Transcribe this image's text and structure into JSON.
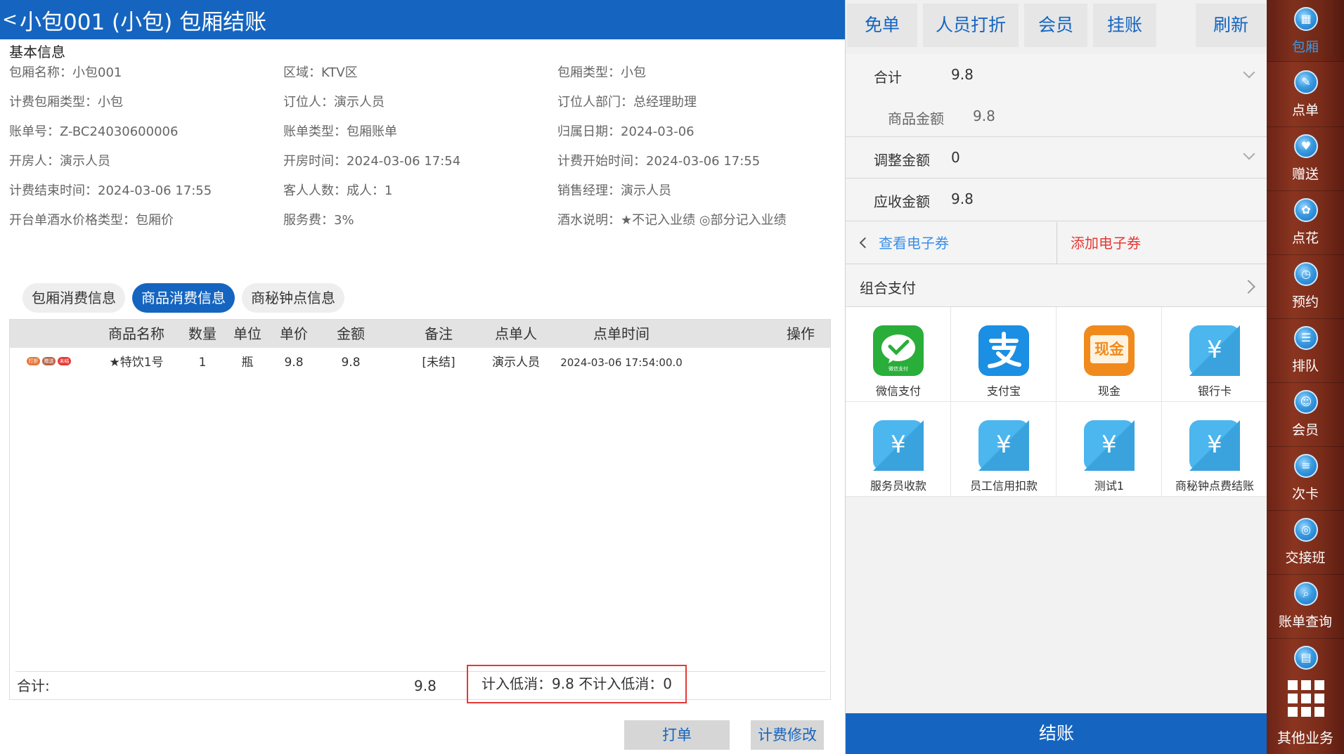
{
  "header": {
    "back_glyph": "<",
    "title": "小包001 (小包) 包厢结账"
  },
  "basic_info": {
    "section_title": "基本信息",
    "rows": [
      [
        "包厢名称：小包001",
        "区域：KTV区",
        "包厢类型：小包"
      ],
      [
        "计费包厢类型：小包",
        "订位人：演示人员",
        "订位人部门：总经理助理"
      ],
      [
        "账单号：Z-BC24030600006",
        "账单类型：包厢账单",
        "归属日期：2024-03-06"
      ],
      [
        "开房人：演示人员",
        "开房时间：2024-03-06 17:54",
        "计费开始时间：2024-03-06 17:55"
      ],
      [
        "计费结束时间：2024-03-06 17:55",
        "客人人数：成人：1",
        "销售经理：演示人员"
      ],
      [
        "开台单酒水价格类型：包厢价",
        "服务费：3%",
        "酒水说明：★不记入业绩 ◎部分记入业绩"
      ]
    ]
  },
  "tabs": [
    {
      "label": "包厢消费信息",
      "active": false
    },
    {
      "label": "商品消费信息",
      "active": true
    },
    {
      "label": "商秘钟点信息",
      "active": false
    }
  ],
  "table": {
    "columns": [
      "商品名称",
      "数量",
      "单位",
      "单价",
      "金额",
      "备注",
      "点单人",
      "点单时间",
      "操作"
    ],
    "rows": [
      {
        "tags": [
          {
            "text": "打折",
            "color": "#e5763a"
          },
          {
            "text": "赠送",
            "color": "#b5654a"
          },
          {
            "text": "未结",
            "color": "#e53935"
          }
        ],
        "name": "★特饮1号",
        "qty": "1",
        "unit": "瓶",
        "price": "9.8",
        "amount": "9.8",
        "remark": "[未结]",
        "orderer": "演示人员",
        "time": "2024-03-06 17:54:00.0",
        "op": ""
      }
    ],
    "footer": {
      "total_label": "合计:",
      "total_value": "9.8",
      "low_consumption": "计入低消：9.8  不计入低消：0"
    }
  },
  "bottom_buttons": {
    "print": "打单",
    "modify": "计费修改"
  },
  "top_buttons": [
    "免单",
    "人员打折",
    "会员",
    "挂账",
    "刷新"
  ],
  "summary": {
    "total_label": "合计",
    "total_value": "9.8",
    "goods_label": "商品金额",
    "goods_value": "9.8",
    "adjust_label": "调整金额",
    "adjust_value": "0",
    "due_label": "应收金额",
    "due_value": "9.8"
  },
  "coupon": {
    "view": "查看电子券",
    "add": "添加电子券"
  },
  "combo_pay": "组合支付",
  "payments": [
    {
      "label": "微信支付",
      "icon": "wechat-pay-icon"
    },
    {
      "label": "支付宝",
      "icon": "alipay-icon"
    },
    {
      "label": "现金",
      "icon": "cash-icon",
      "icon_text": "现金"
    },
    {
      "label": "银行卡",
      "icon": "yen-card-icon"
    },
    {
      "label": "服务员收款",
      "icon": "yen-card-icon"
    },
    {
      "label": "员工信用扣款",
      "icon": "yen-card-icon"
    },
    {
      "label": "测试1",
      "icon": "yen-card-icon"
    },
    {
      "label": "商秘钟点费结账",
      "icon": "yen-card-icon"
    }
  ],
  "wechat_pay_icon_text": "微信支付",
  "checkout_label": "结账",
  "sidebar": {
    "items": [
      {
        "label": "包厢",
        "icon": "room-icon"
      },
      {
        "label": "点单",
        "icon": "order-icon"
      },
      {
        "label": "赠送",
        "icon": "gift-icon"
      },
      {
        "label": "点花",
        "icon": "flower-icon"
      },
      {
        "label": "预约",
        "icon": "reserve-icon"
      },
      {
        "label": "排队",
        "icon": "queue-icon"
      },
      {
        "label": "会员",
        "icon": "member-icon"
      },
      {
        "label": "次卡",
        "icon": "count-card-icon"
      },
      {
        "label": "交接班",
        "icon": "shift-icon"
      },
      {
        "label": "账单查询",
        "icon": "bill-query-icon"
      }
    ],
    "more_label": "其他业务"
  },
  "colors": {
    "primary": "#1565c0",
    "danger": "#e53935",
    "sidebar": "#7a2c1a"
  }
}
